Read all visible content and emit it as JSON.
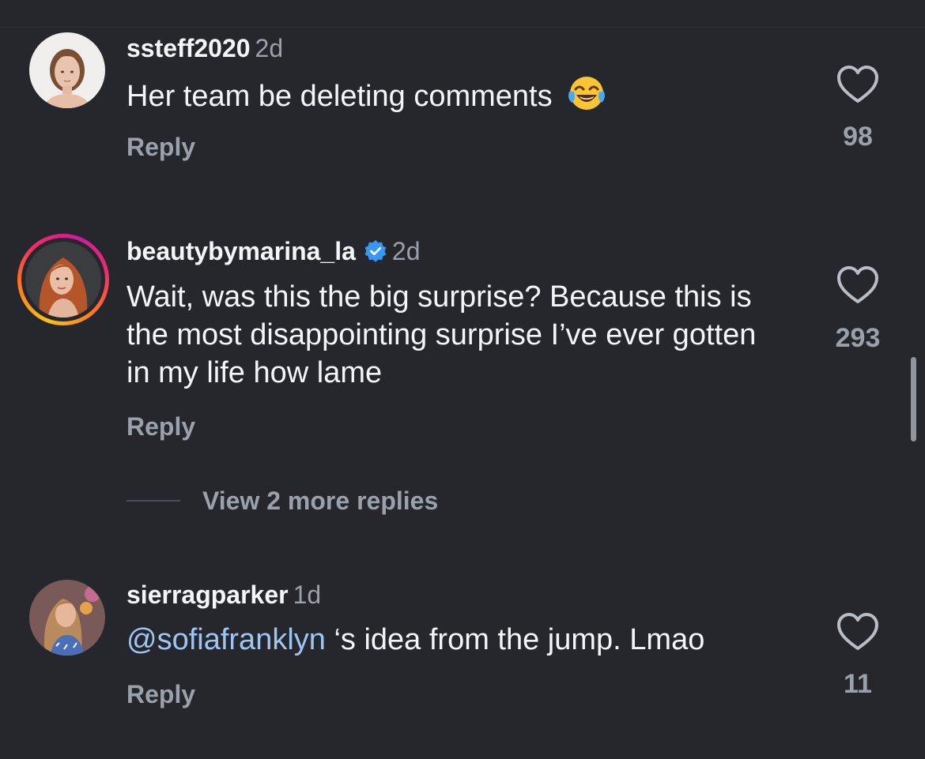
{
  "comments": [
    {
      "username": "ssteff2020",
      "time": "2d",
      "text": "Her team be deleting comments",
      "emoji": "face-with-tears-of-joy",
      "reply_label": "Reply",
      "likes": "98",
      "verified": false
    },
    {
      "username": "beautybymarina_la",
      "time": "2d",
      "text": "Wait, was this the big surprise? Because this is the most disappointing surprise I’ve ever gotten in my life how lame",
      "reply_label": "Reply",
      "likes": "293",
      "verified": true,
      "has_story_ring": true
    },
    {
      "username": "sierragparker",
      "time": "1d",
      "mention": "@sofiafranklyn",
      "text": " ‘s idea from the jump. Lmao",
      "reply_label": "Reply",
      "likes": "11",
      "verified": false
    }
  ],
  "view_more_replies": "View 2 more replies",
  "icons": {
    "like": "heart-outline-icon",
    "verified": "verified-badge-icon"
  },
  "colors": {
    "background": "#25272d",
    "primary_text": "#f4f5f7",
    "secondary_text": "#9ba1ab",
    "mention": "#9fc6f3",
    "verified": "#3897f0"
  }
}
